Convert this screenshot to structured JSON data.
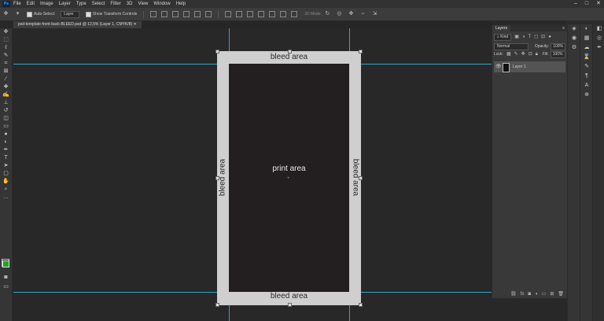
{
  "app": {
    "logo": "Ps"
  },
  "menu": [
    "File",
    "Edit",
    "Image",
    "Layer",
    "Type",
    "Select",
    "Filter",
    "3D",
    "View",
    "Window",
    "Help"
  ],
  "window_controls": [
    "–",
    "□",
    "✕"
  ],
  "options": {
    "auto_select_label": "Auto-Select:",
    "auto_select_value": "Layer",
    "show_transform_label": "Show Transform Controls",
    "mode_3d_label": "3D Mode:"
  },
  "document_tab": "psd-template-front-back-BLEED.psd @ 12,5% (Layer 1, CMYK/8)",
  "canvas": {
    "top_label": "bleed area",
    "bottom_label": "bleed area",
    "left_label": "bleed area",
    "right_label": "bleed area",
    "center_label": "print area"
  },
  "layers_panel": {
    "title": "Layers",
    "filter_label": "Kind",
    "blend_mode": "Normal",
    "opacity_label": "Opacity:",
    "opacity_value": "100%",
    "lock_label": "Lock:",
    "fill_label": "Fill:",
    "fill_value": "100%",
    "layer_name": "Layer 1"
  },
  "colors": {
    "accent_guide": "#2aa7c4",
    "foreground_color": "#1ea620",
    "print_area": "#231f20",
    "bleed_area": "#cfcfcf"
  }
}
